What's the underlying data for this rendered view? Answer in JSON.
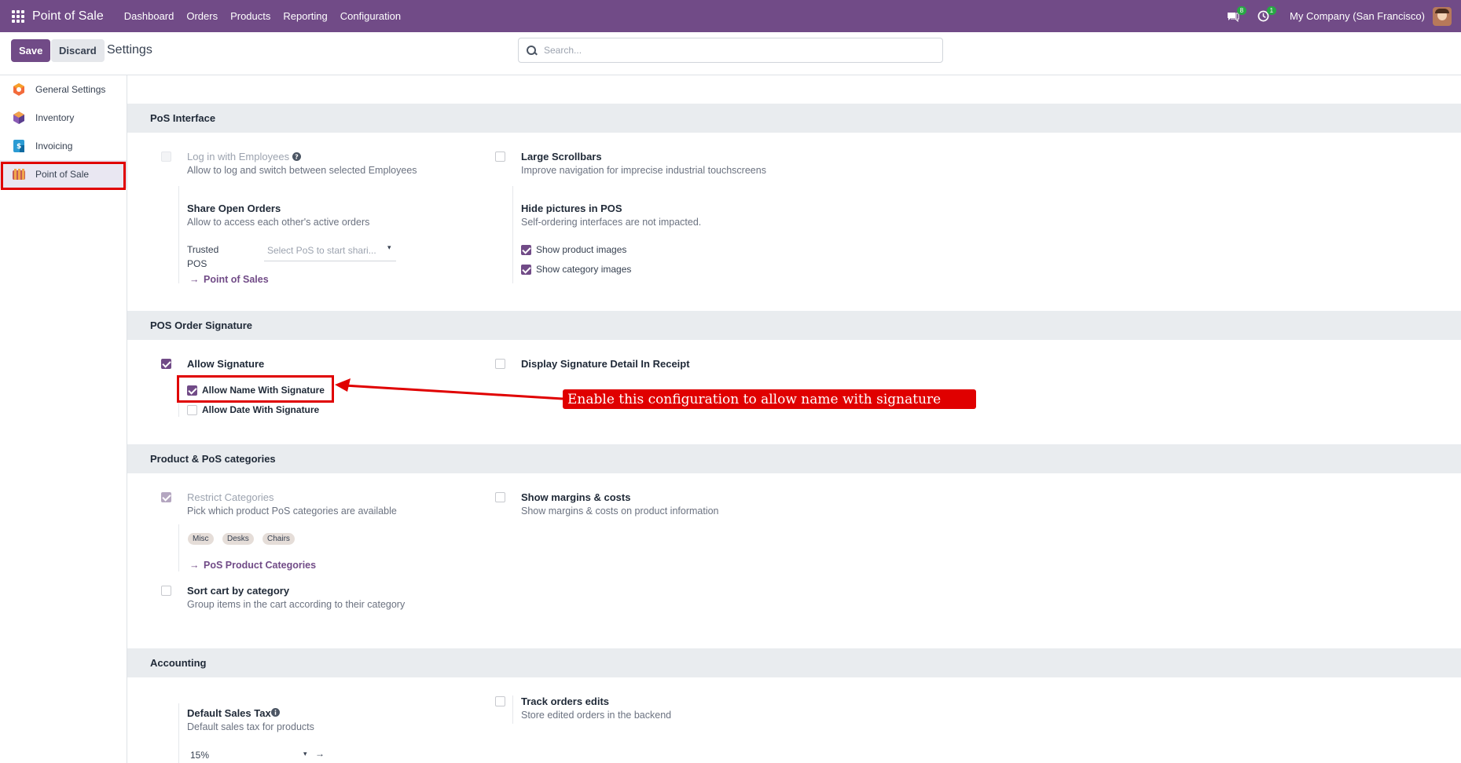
{
  "navbar": {
    "brand": "Point of Sale",
    "menu": [
      "Dashboard",
      "Orders",
      "Products",
      "Reporting",
      "Configuration"
    ],
    "messages_badge": "8",
    "activities_badge": "1",
    "company": "My Company (San Francisco)"
  },
  "control_panel": {
    "save": "Save",
    "discard": "Discard",
    "title": "Settings",
    "search_placeholder": "Search..."
  },
  "sidebar": {
    "items": [
      {
        "label": "General Settings",
        "icon": "general-settings-icon"
      },
      {
        "label": "Inventory",
        "icon": "inventory-icon"
      },
      {
        "label": "Invoicing",
        "icon": "invoicing-icon"
      },
      {
        "label": "Point of Sale",
        "icon": "point-of-sale-icon",
        "active": true
      }
    ]
  },
  "pos_interface": {
    "title": "PoS Interface",
    "login_employees": {
      "label": "Log in with Employees",
      "desc": "Allow to log and switch between selected Employees",
      "checked": false
    },
    "large_scrollbars": {
      "label": "Large Scrollbars",
      "desc": "Improve navigation for imprecise industrial touchscreens",
      "checked": false
    },
    "share_open_orders": {
      "label": "Share Open Orders",
      "desc": "Allow to access each other's active orders"
    },
    "trusted_pos": {
      "label_1": "Trusted",
      "label_2": "POS",
      "placeholder": "Select PoS to start shari..."
    },
    "point_of_sales_link": "Point of Sales",
    "hide_pictures": {
      "label": "Hide pictures in POS",
      "desc": "Self-ordering interfaces are not impacted."
    },
    "show_product_images": {
      "label": "Show product images",
      "checked": true
    },
    "show_category_images": {
      "label": "Show category images",
      "checked": true
    }
  },
  "pos_order_signature": {
    "title": "POS Order Signature",
    "allow_signature": {
      "label": "Allow Signature",
      "checked": true
    },
    "display_signature_detail": {
      "label": "Display Signature Detail In Receipt",
      "checked": false
    },
    "allow_name_with_signature": {
      "label": "Allow Name With Signature",
      "checked": true
    },
    "allow_date_with_signature": {
      "label": "Allow Date With Signature",
      "checked": false
    }
  },
  "annotation": {
    "callout": "Enable this configuration to allow name with signature",
    "color": "#e00000"
  },
  "product_categories": {
    "title": "Product & PoS categories",
    "restrict_categories": {
      "label": "Restrict Categories",
      "desc": "Pick which product PoS categories are available",
      "checked": true
    },
    "tags": [
      "Misc",
      "Desks",
      "Chairs"
    ],
    "pos_product_categories_link": "PoS Product Categories",
    "show_margins": {
      "label": "Show margins & costs",
      "desc": "Show margins & costs on product information",
      "checked": false
    },
    "sort_cart": {
      "label": "Sort cart by category",
      "desc": "Group items in the cart according to their category",
      "checked": false
    }
  },
  "accounting": {
    "title": "Accounting",
    "default_sales_tax": {
      "label": "Default Sales Tax",
      "desc": "Default sales tax for products",
      "value": "15%"
    },
    "track_orders_edits": {
      "label": "Track orders edits",
      "desc": "Store edited orders in the backend",
      "checked": false
    }
  },
  "colors": {
    "brand": "#714b87",
    "section_bg": "#e9ecef",
    "highlight": "#e00000"
  }
}
